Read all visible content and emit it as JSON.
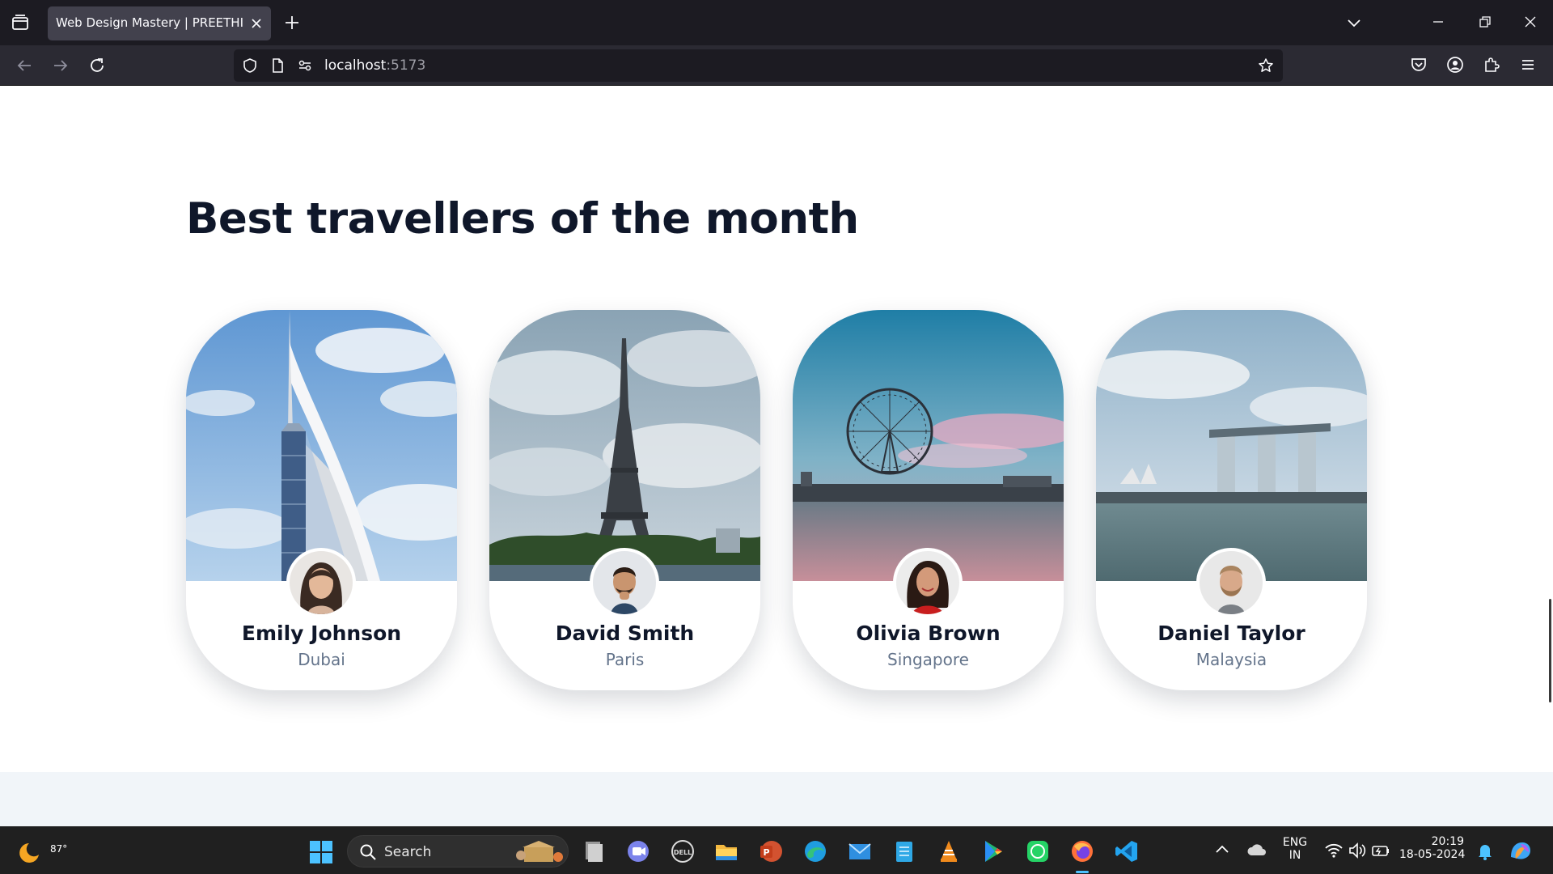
{
  "browser": {
    "tab_title": "Web Design Mastery | PREETHI",
    "url_host": "localhost",
    "url_port": ":5173"
  },
  "page": {
    "section_title": "Best travellers of the month",
    "travellers": [
      {
        "name": "Emily Johnson",
        "location": "Dubai"
      },
      {
        "name": "David Smith",
        "location": "Paris"
      },
      {
        "name": "Olivia Brown",
        "location": "Singapore"
      },
      {
        "name": "Daniel Taylor",
        "location": "Malaysia"
      }
    ]
  },
  "taskbar": {
    "weather_temp": "87°",
    "search_label": "Search",
    "lang_line1": "ENG",
    "lang_line2": "IN",
    "time": "20:19",
    "date": "18-05-2024",
    "icons": [
      "start-icon",
      "search-icon",
      "file-explorer-icon",
      "teams-icon",
      "dell-icon",
      "folder-icon",
      "powerpoint-icon",
      "edge-icon",
      "mail-icon",
      "notepad-icon",
      "vlc-icon",
      "play-store-icon",
      "whatsapp-icon",
      "firefox-icon",
      "vscode-icon"
    ]
  }
}
